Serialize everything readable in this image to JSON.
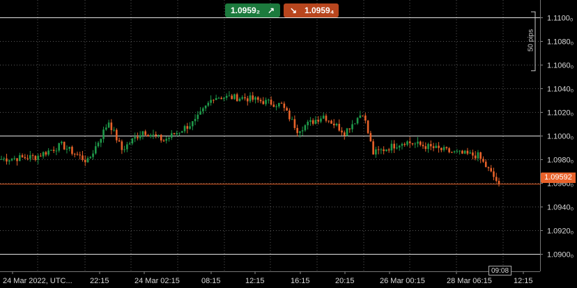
{
  "trade_buttons": {
    "buy_price": "1.0959₂",
    "sell_price": "1.0959₄",
    "buy_icon": "arrow-up-right-icon",
    "sell_icon": "arrow-down-right-icon",
    "buy_color": "#1c7a3d",
    "sell_color": "#b8461e"
  },
  "pips_ruler_label": "50 pips",
  "current_price_label": "1.09592",
  "crosshair_time_label": "09:08",
  "chart_data": {
    "type": "candlestick",
    "instrument_price_axis": {
      "min": 1.0885,
      "max": 1.1115,
      "tick_labels": [
        "1.1100₀",
        "1.1080₀",
        "1.1060₀",
        "1.1040₀",
        "1.1020₀",
        "1.1000₀",
        "1.0980₀",
        "1.0960₀",
        "1.0940₀",
        "1.0920₀",
        "1.0900₀"
      ],
      "tick_values": [
        1.11,
        1.108,
        1.106,
        1.104,
        1.102,
        1.1,
        1.098,
        1.096,
        1.094,
        1.092,
        1.09
      ],
      "highlighted_levels": [
        1.11,
        1.1,
        1.09
      ]
    },
    "time_axis_labels": [
      "24 Mar 2022, UTC...",
      "22:15",
      "24 Mar 02:15",
      "08:15",
      "12:15",
      "16:15",
      "20:15",
      "26 Mar 00:15",
      "28 Mar 06:15",
      "12:15"
    ],
    "current_price": 1.09592,
    "pips_ruler_range": [
      1.1105,
      1.1055
    ],
    "grid": true,
    "colors": {
      "up": "#1f9a4a",
      "down": "#e8622a",
      "price_line": "#e8622a",
      "grid": "#5a5a5a"
    },
    "segments": [
      {
        "from": 1.098,
        "to": 1.0982,
        "bars": 14
      },
      {
        "from": 1.0982,
        "to": 1.0992,
        "bars": 10
      },
      {
        "from": 1.0992,
        "to": 1.0978,
        "bars": 10
      },
      {
        "from": 1.0978,
        "to": 1.1012,
        "bars": 8
      },
      {
        "from": 1.1012,
        "to": 1.0988,
        "bars": 5
      },
      {
        "from": 1.0988,
        "to": 1.1004,
        "bars": 8
      },
      {
        "from": 1.1004,
        "to": 1.0996,
        "bars": 8
      },
      {
        "from": 1.0996,
        "to": 1.1012,
        "bars": 12
      },
      {
        "from": 1.1012,
        "to": 1.1033,
        "bars": 7
      },
      {
        "from": 1.1033,
        "to": 1.1032,
        "bars": 12
      },
      {
        "from": 1.1032,
        "to": 1.1026,
        "bars": 14
      },
      {
        "from": 1.1026,
        "to": 1.1005,
        "bars": 6
      },
      {
        "from": 1.1005,
        "to": 1.1017,
        "bars": 10
      },
      {
        "from": 1.1017,
        "to": 1.1003,
        "bars": 8
      },
      {
        "from": 1.1003,
        "to": 1.102,
        "bars": 7
      },
      {
        "from": 1.102,
        "to": 1.0985,
        "bars": 4
      },
      {
        "from": 1.0985,
        "to": 1.0995,
        "bars": 12
      },
      {
        "from": 1.0995,
        "to": 1.0985,
        "bars": 20
      },
      {
        "from": 1.0985,
        "to": 1.0983,
        "bars": 8
      },
      {
        "from": 1.0983,
        "to": 1.0959,
        "bars": 8
      }
    ]
  }
}
